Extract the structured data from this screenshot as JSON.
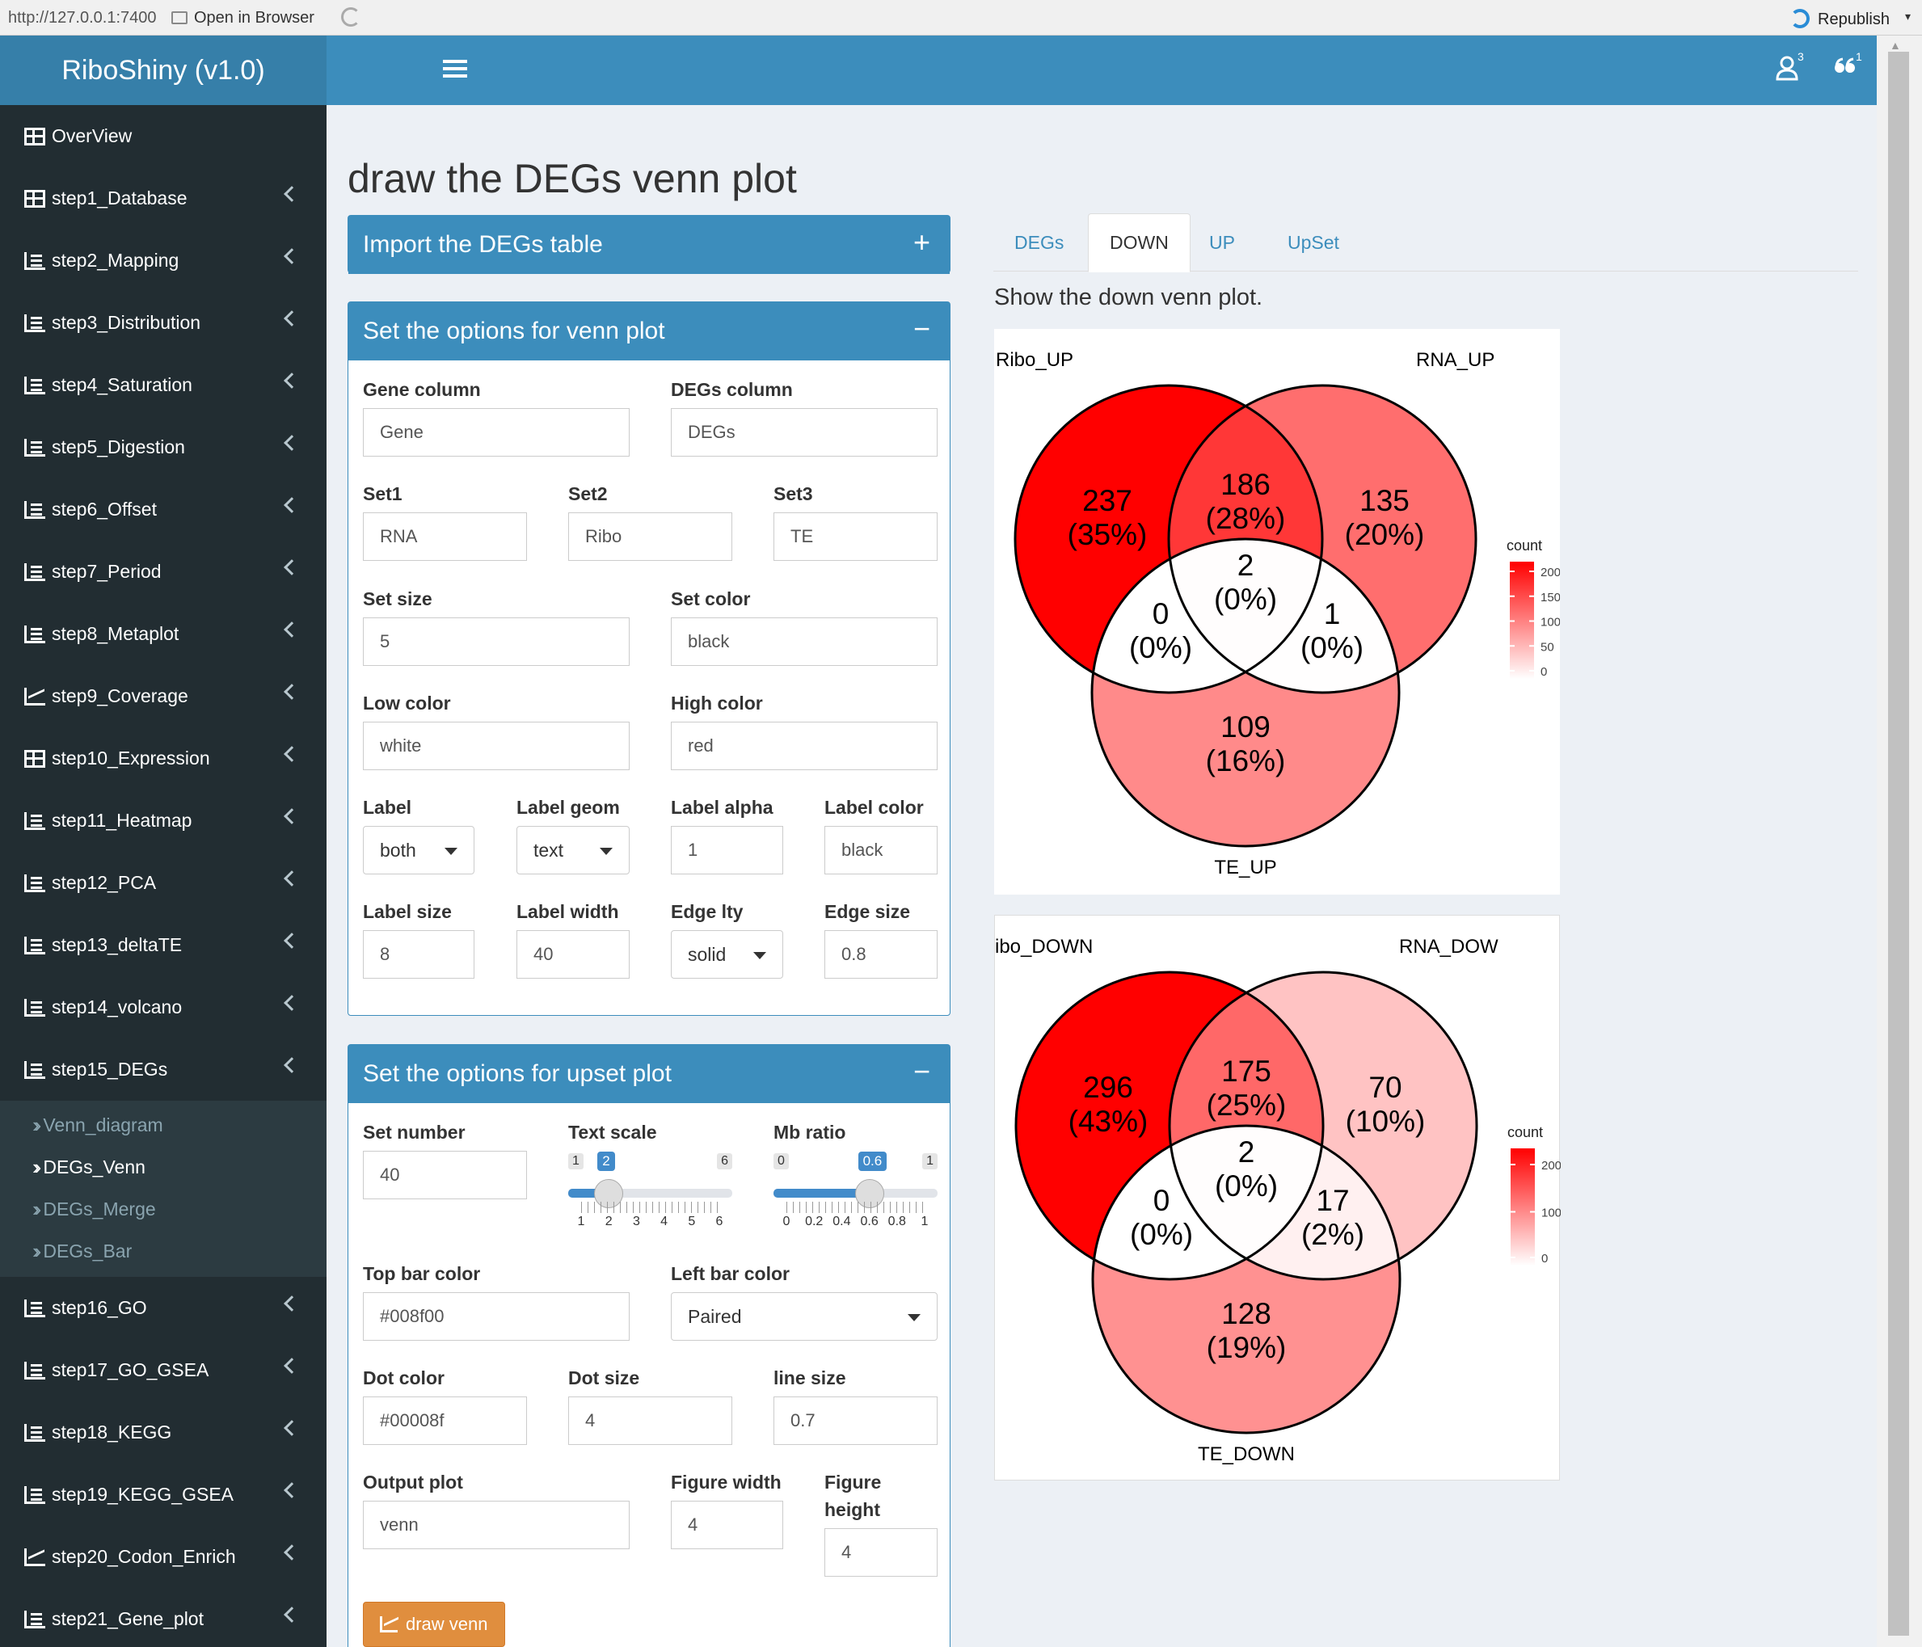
{
  "browser": {
    "url": "http://127.0.0.1:7400",
    "open_label": "Open in Browser",
    "republish_label": "Republish"
  },
  "header": {
    "title": "RiboShiny (v1.0)",
    "user_badge": "3",
    "quote_badge": "1"
  },
  "sidebar": {
    "items": [
      {
        "label": "OverView",
        "icon": "grid-icon",
        "chev": false
      },
      {
        "label": "step1_Database",
        "icon": "grid-icon",
        "chev": true
      },
      {
        "label": "step2_Mapping",
        "icon": "list-icon",
        "chev": true
      },
      {
        "label": "step3_Distribution",
        "icon": "list-icon",
        "chev": true
      },
      {
        "label": "step4_Saturation",
        "icon": "list-icon",
        "chev": true
      },
      {
        "label": "step5_Digestion",
        "icon": "list-icon",
        "chev": true
      },
      {
        "label": "step6_Offset",
        "icon": "list-icon",
        "chev": true
      },
      {
        "label": "step7_Period",
        "icon": "list-icon",
        "chev": true
      },
      {
        "label": "step8_Metaplot",
        "icon": "list-icon",
        "chev": true
      },
      {
        "label": "step9_Coverage",
        "icon": "line-chart-icon",
        "chev": true
      },
      {
        "label": "step10_Expression",
        "icon": "grid-icon",
        "chev": true
      },
      {
        "label": "step11_Heatmap",
        "icon": "list-icon",
        "chev": true
      },
      {
        "label": "step12_PCA",
        "icon": "list-icon",
        "chev": true
      },
      {
        "label": "step13_deltaTE",
        "icon": "list-icon",
        "chev": true
      },
      {
        "label": "step14_volcano",
        "icon": "list-icon",
        "chev": true
      },
      {
        "label": "step15_DEGs",
        "icon": "list-icon",
        "chev": true
      }
    ],
    "subitems": [
      {
        "label": "Venn_diagram",
        "active": false
      },
      {
        "label": "DEGs_Venn",
        "active": true
      },
      {
        "label": "DEGs_Merge",
        "active": false
      },
      {
        "label": "DEGs_Bar",
        "active": false
      }
    ],
    "items2": [
      {
        "label": "step16_GO",
        "icon": "list-icon"
      },
      {
        "label": "step17_GO_GSEA",
        "icon": "list-icon"
      },
      {
        "label": "step18_KEGG",
        "icon": "list-icon"
      },
      {
        "label": "step19_KEGG_GSEA",
        "icon": "list-icon"
      },
      {
        "label": "step20_Codon_Enrich",
        "icon": "line-chart-icon"
      },
      {
        "label": "step21_Gene_plot",
        "icon": "list-icon"
      }
    ]
  },
  "page": {
    "title": "draw the DEGs venn plot"
  },
  "import_box": {
    "title": "Import the DEGs table",
    "tool": "+"
  },
  "venn_box": {
    "title": "Set the options for venn plot",
    "tool": "−",
    "gene_column": {
      "label": "Gene column",
      "value": "Gene"
    },
    "degs_column": {
      "label": "DEGs column",
      "value": "DEGs"
    },
    "set1": {
      "label": "Set1",
      "value": "RNA"
    },
    "set2": {
      "label": "Set2",
      "value": "Ribo"
    },
    "set3": {
      "label": "Set3",
      "value": "TE"
    },
    "set_size": {
      "label": "Set size",
      "value": "5"
    },
    "set_color": {
      "label": "Set color",
      "value": "black"
    },
    "low_color": {
      "label": "Low color",
      "value": "white"
    },
    "high_color": {
      "label": "High color",
      "value": "red"
    },
    "label": {
      "label": "Label",
      "value": "both"
    },
    "label_geom": {
      "label": "Label geom",
      "value": "text"
    },
    "label_alpha": {
      "label": "Label alpha",
      "value": "1"
    },
    "label_color": {
      "label": "Label color",
      "value": "black"
    },
    "label_size": {
      "label": "Label size",
      "value": "8"
    },
    "label_width": {
      "label": "Label width",
      "value": "40"
    },
    "edge_lty": {
      "label": "Edge lty",
      "value": "solid"
    },
    "edge_size": {
      "label": "Edge size",
      "value": "0.8"
    }
  },
  "upset_box": {
    "title": "Set the options for upset plot",
    "tool": "−",
    "set_number": {
      "label": "Set number",
      "value": "40"
    },
    "text_scale": {
      "label": "Text scale",
      "min": "1",
      "max": "6",
      "value": "2",
      "ticks": [
        "1",
        "2",
        "3",
        "4",
        "5",
        "6"
      ],
      "fraction": 0.2
    },
    "mb_ratio": {
      "label": "Mb ratio",
      "min": "0",
      "max": "1",
      "value": "0.6",
      "ticks": [
        "0",
        "0.2",
        "0.4",
        "0.6",
        "0.8",
        "1"
      ],
      "fraction": 0.6
    },
    "top_bar_color": {
      "label": "Top bar color",
      "value": "#008f00"
    },
    "left_bar_color": {
      "label": "Left bar color",
      "value": "Paired"
    },
    "dot_color": {
      "label": "Dot color",
      "value": "#00008f"
    },
    "dot_size": {
      "label": "Dot size",
      "value": "4"
    },
    "line_size": {
      "label": "line size",
      "value": "0.7"
    },
    "output_plot": {
      "label": "Output plot",
      "value": "venn"
    },
    "figure_width": {
      "label": "Figure width",
      "value": "4"
    },
    "figure_height": {
      "label": "Figure height",
      "value": "4"
    },
    "draw_label": "draw venn"
  },
  "tabs": [
    {
      "label": "DEGs"
    },
    {
      "label": "DOWN",
      "active": true
    },
    {
      "label": "UP"
    },
    {
      "label": "UpSet"
    }
  ],
  "tab_text": "Show the down venn plot.",
  "colors": {
    "primary": "#3c8dbc",
    "sidebar": "#222d32",
    "button": "#e08e3e",
    "venn_low": "#ffffff",
    "venn_high": "#ff0000"
  },
  "chart_data": [
    {
      "type": "venn",
      "sets": [
        "Ribo_UP",
        "RNA_UP",
        "TE_UP"
      ],
      "regions": [
        {
          "id": "A",
          "value": 237,
          "label1": "237",
          "label2": "(35%)"
        },
        {
          "id": "AB",
          "value": 186,
          "label1": "186",
          "label2": "(28%)"
        },
        {
          "id": "B",
          "value": 135,
          "label1": "135",
          "label2": "(20%)"
        },
        {
          "id": "ABC",
          "value": 2,
          "label1": "2",
          "label2": "(0%)"
        },
        {
          "id": "AC",
          "value": 0,
          "label1": "0",
          "label2": "(0%)"
        },
        {
          "id": "BC",
          "value": 1,
          "label1": "1",
          "label2": "(0%)"
        },
        {
          "id": "C",
          "value": 109,
          "label1": "109",
          "label2": "(16%)"
        }
      ],
      "legend_title": "count",
      "legend_ticks": [
        "200",
        "150",
        "100",
        "50",
        "0"
      ],
      "max": 237
    },
    {
      "type": "venn",
      "sets": [
        "ibo_DOWN",
        "RNA_DOW",
        "TE_DOWN"
      ],
      "regions": [
        {
          "id": "A",
          "value": 296,
          "label1": "296",
          "label2": "(43%)"
        },
        {
          "id": "AB",
          "value": 175,
          "label1": "175",
          "label2": "(25%)"
        },
        {
          "id": "B",
          "value": 70,
          "label1": "70",
          "label2": "(10%)"
        },
        {
          "id": "ABC",
          "value": 2,
          "label1": "2",
          "label2": "(0%)"
        },
        {
          "id": "AC",
          "value": 0,
          "label1": "0",
          "label2": "(0%)"
        },
        {
          "id": "BC",
          "value": 17,
          "label1": "17",
          "label2": "(2%)"
        },
        {
          "id": "C",
          "value": 128,
          "label1": "128",
          "label2": "(19%)"
        }
      ],
      "legend_title": "count",
      "legend_ticks": [
        "200",
        "100",
        "0"
      ],
      "max": 296
    }
  ]
}
